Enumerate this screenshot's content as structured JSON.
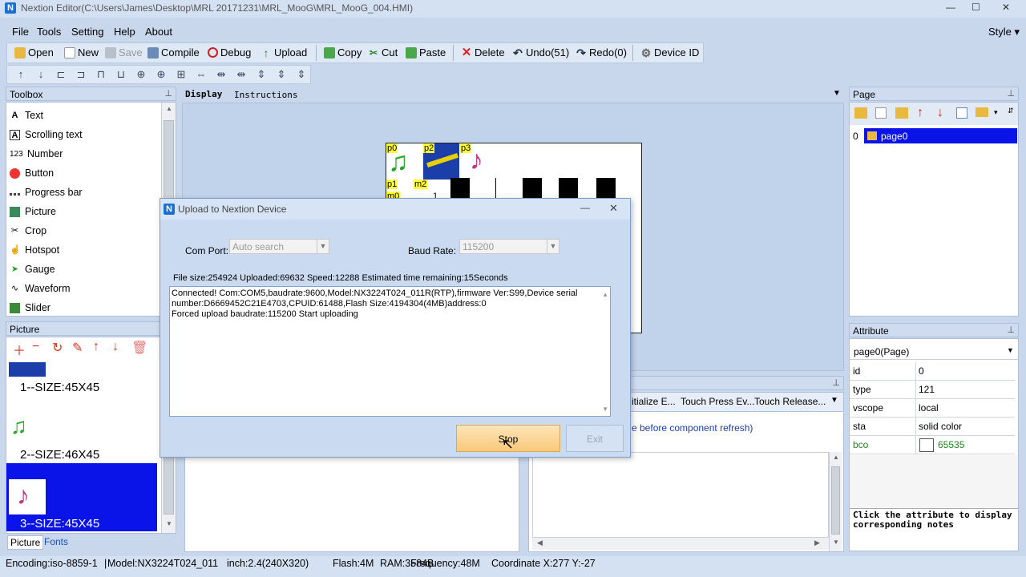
{
  "window": {
    "title": "Nextion Editor(C:\\Users\\James\\Desktop\\MRL 20171231\\MRL_MooG\\MRL_MooG_004.HMI)",
    "minimize": "—",
    "maximize": "☐",
    "close": "✕"
  },
  "menu": {
    "file": "File",
    "tools": "Tools",
    "setting": "Setting",
    "help": "Help",
    "about": "About",
    "style": "Style"
  },
  "toolbar": {
    "open": "Open",
    "new": "New",
    "save": "Save",
    "compile": "Compile",
    "debug": "Debug",
    "upload": "Upload",
    "copy": "Copy",
    "cut": "Cut",
    "paste": "Paste",
    "delete": "Delete",
    "undo": "Undo(51)",
    "redo": "Redo(0)",
    "device_id": "Device  ID"
  },
  "toolbox": {
    "title": "Toolbox",
    "items": [
      "Text",
      "Scrolling text",
      "Number",
      "Button",
      "Progress bar",
      "Picture",
      "Crop",
      "Hotspot",
      "Gauge",
      "Waveform",
      "Slider"
    ]
  },
  "picture_panel": {
    "title": "Picture",
    "items": [
      "1--SIZE:45X45",
      "2--SIZE:46X45",
      "3--SIZE:45X45"
    ],
    "tab_picture": "Picture",
    "tab_fonts": "Fonts"
  },
  "display": {
    "tab_display": "Display",
    "tab_instructions": "Instructions",
    "components": [
      "p0",
      "p2",
      "p3",
      "p1",
      "m2",
      "m0",
      "1"
    ]
  },
  "page_panel": {
    "title": "Page",
    "index": "0",
    "page_name": "page0"
  },
  "attribute_panel": {
    "title": "Attribute",
    "selected": "page0(Page)",
    "rows": [
      {
        "key": "id",
        "value": "0"
      },
      {
        "key": "type",
        "value": "121"
      },
      {
        "key": "vscope",
        "value": "local"
      },
      {
        "key": "sta",
        "value": "solid color"
      },
      {
        "key": "bco",
        "value": "65535"
      }
    ],
    "note": "Click the attribute to display corresponding notes"
  },
  "events": {
    "tab1": "itialize E...",
    "tab2": "Touch Press Ev...",
    "tab3": "Touch Release...",
    "body_text": "e before component refresh)"
  },
  "dialog": {
    "title": "Upload to Nextion Device",
    "com_port_label": "Com Port:",
    "com_port_value": "Auto search",
    "baud_rate_label": "Baud Rate:",
    "baud_rate_value": "115200",
    "progress_text": "File size:254924 Uploaded:69632 Speed:12288 Estimated time remaining:15Seconds",
    "log_line1": "Connected! Com:COM5,baudrate:9600,Model:NX3224T024_011R(RTP),firmware Ver:S99,Device serial",
    "log_line2": "number:D6669452C21E4703,CPUID:61488,Flash Size:4194304(4MB)address:0",
    "log_line3": "Forced upload baudrate:115200  Start uploading",
    "stop": "Stop",
    "exit": "Exit"
  },
  "status": {
    "encoding": "Encoding:iso-8859-1",
    "model": "Model:NX3224T024_011",
    "inch": "inch:2.4(240X320)",
    "flash": "Flash:4M",
    "ram": "RAM:3584B",
    "frequency": "Frequency:48M",
    "coordinate": "Coordinate X:277  Y:-27"
  }
}
